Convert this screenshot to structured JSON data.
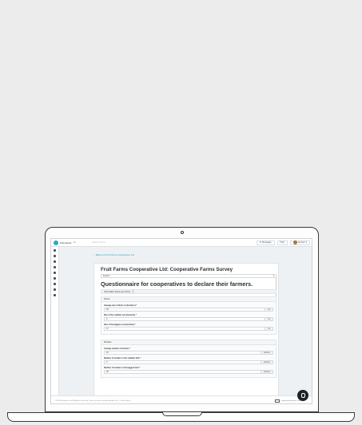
{
  "topbar": {
    "brand": "Farmquest",
    "brand_sub": "Sia",
    "search_placeholder": "Search surveys",
    "messages_label": "Messages",
    "help_label": "Help",
    "account_label": "Account"
  },
  "sidebar": {
    "icons": [
      "menu-icon",
      "home-icon",
      "chart-icon",
      "camera-icon",
      "calendar-icon",
      "bar-chart-icon",
      "mail-icon",
      "document-icon",
      "settings-icon"
    ]
  },
  "back_link": "← Back to Fruit Farms Cooperative Ltd",
  "survey": {
    "title": "Fruit Farms Cooperative Ltd: Cooperative Farms Survey",
    "language": "English",
    "questionnaire_title": "Questionnaire for cooperatives to declare their farmers.",
    "section": "Information about your farms"
  },
  "farms": {
    "heading": "Farms",
    "fields": [
      {
        "label": "Average size of farms in (hectares) *",
        "value": "25",
        "unit": "ha"
      },
      {
        "label": "Size of the smallest one (hectares) *",
        "value": "4",
        "unit": "ha"
      },
      {
        "label": "Size of the biggest one (hectares) *",
        "value": "17",
        "unit": "ha"
      }
    ]
  },
  "workers": {
    "heading": "Workers",
    "fields": [
      {
        "label": "Average number of workers *",
        "value": "10",
        "unit": "workers"
      },
      {
        "label": "Number of workers in the smallest farm *",
        "value": "3",
        "unit": "workers"
      },
      {
        "label": "Number of workers in the biggest farm *",
        "value": "40",
        "unit": "workers"
      }
    ]
  },
  "footer": {
    "copyright": "© 2020 Farmquest Ltd. All Rights Reserved. Terms of Service and Acceptable Use · Privacy Notice",
    "support": "support@farmquest.com"
  }
}
